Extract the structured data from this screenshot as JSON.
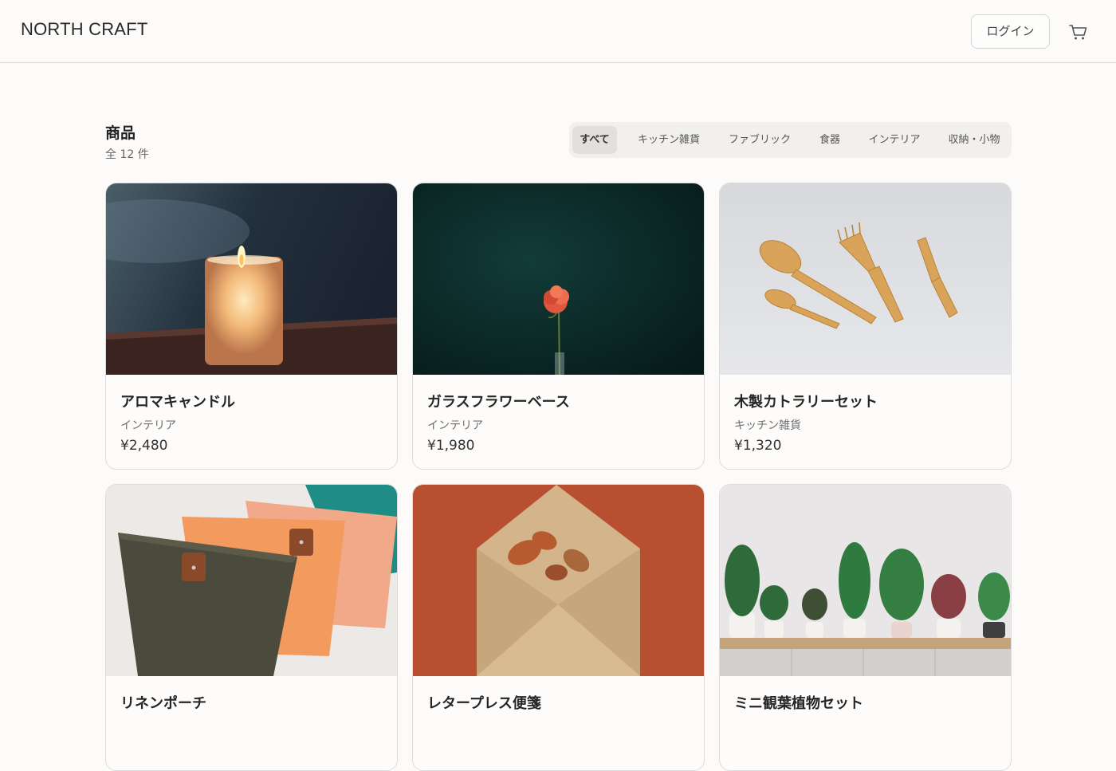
{
  "header": {
    "brand": "NORTH CRAFT",
    "login_label": "ログイン",
    "cart_icon": "cart-icon"
  },
  "section": {
    "title": "商品",
    "count": "全 12 件"
  },
  "filters": [
    {
      "label": "すべて",
      "active": true
    },
    {
      "label": "キッチン雑貨",
      "active": false
    },
    {
      "label": "ファブリック",
      "active": false
    },
    {
      "label": "食器",
      "active": false
    },
    {
      "label": "インテリア",
      "active": false
    },
    {
      "label": "収納・小物",
      "active": false
    }
  ],
  "products": [
    {
      "name": "アロマキャンドル",
      "category": "インテリア",
      "price": "¥2,480"
    },
    {
      "name": "ガラスフラワーベース",
      "category": "インテリア",
      "price": "¥1,980"
    },
    {
      "name": "木製カトラリーセット",
      "category": "キッチン雑貨",
      "price": "¥1,320"
    },
    {
      "name": "リネンポーチ",
      "category": "",
      "price": ""
    },
    {
      "name": "レタープレス便箋",
      "category": "",
      "price": ""
    },
    {
      "name": "ミニ観葉植物セット",
      "category": "",
      "price": ""
    }
  ]
}
